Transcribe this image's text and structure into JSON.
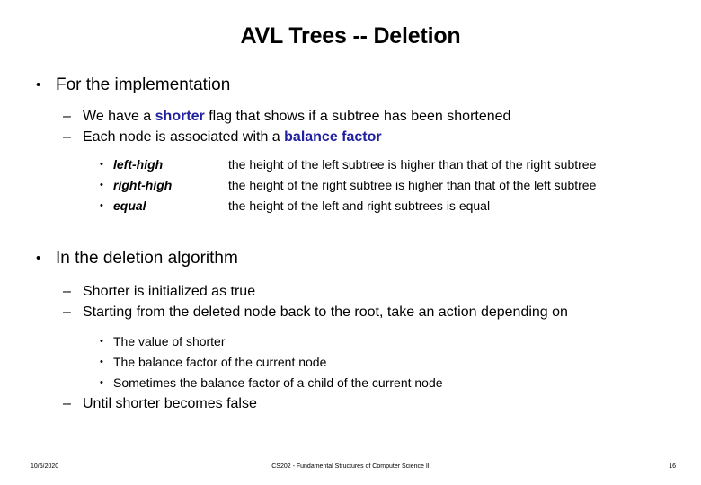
{
  "slide": {
    "title": "AVL Trees -- Deletion",
    "accent_color": "#2020a0",
    "text_color": "#000000",
    "background_color": "#ffffff",
    "bullet_glyph_level1": "•",
    "bullet_glyph_level2": "–",
    "bullet_glyph_level3": "•"
  },
  "section1": {
    "heading": "For the implementation",
    "points": [
      {
        "prefix": "We have a ",
        "highlight": "shorter",
        "suffix": " flag that shows if a subtree has been shortened"
      },
      {
        "prefix": "Each node is associated with a ",
        "highlight": "balance factor",
        "suffix": ""
      }
    ],
    "factors": [
      {
        "term": "left-high",
        "description": "the height of the left subtree is higher than that of the right subtree"
      },
      {
        "term": "right-high",
        "description": "the height of the right subtree is higher than that of the left subtree"
      },
      {
        "term": "equal",
        "description": "the height of the left and right subtrees is equal"
      }
    ]
  },
  "section2": {
    "heading": "In the deletion algorithm",
    "points": [
      "Shorter is initialized as true",
      "Starting from the deleted node back to the root, take an action depending on"
    ],
    "conditions": [
      "The value of shorter",
      "The balance factor of the current node",
      "Sometimes the balance factor of a child of the current node"
    ],
    "closing": "Until shorter becomes false"
  },
  "footer": {
    "date": "10/6/2020",
    "course": "CS202 - Fundamental Structures of Computer Science II",
    "page": "16"
  }
}
